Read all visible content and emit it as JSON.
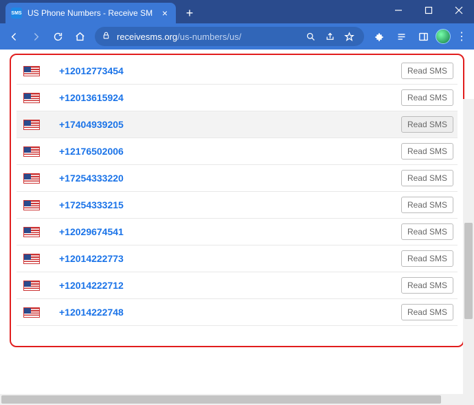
{
  "window": {
    "tab_title": "US Phone Numbers - Receive SM",
    "tab_favicon_text": "SMS"
  },
  "omnibox": {
    "domain": "receivesms.org",
    "path": "/us-numbers/us/"
  },
  "buttons": {
    "read_sms": "Read SMS"
  },
  "phones": [
    {
      "number": "+12012773454",
      "highlight": false
    },
    {
      "number": "+12013615924",
      "highlight": false
    },
    {
      "number": "+17404939205",
      "highlight": true
    },
    {
      "number": "+12176502006",
      "highlight": false
    },
    {
      "number": "+17254333220",
      "highlight": false
    },
    {
      "number": "+17254333215",
      "highlight": false
    },
    {
      "number": "+12029674541",
      "highlight": false
    },
    {
      "number": "+12014222773",
      "highlight": false
    },
    {
      "number": "+12014222712",
      "highlight": false
    },
    {
      "number": "+12014222748",
      "highlight": false
    }
  ]
}
